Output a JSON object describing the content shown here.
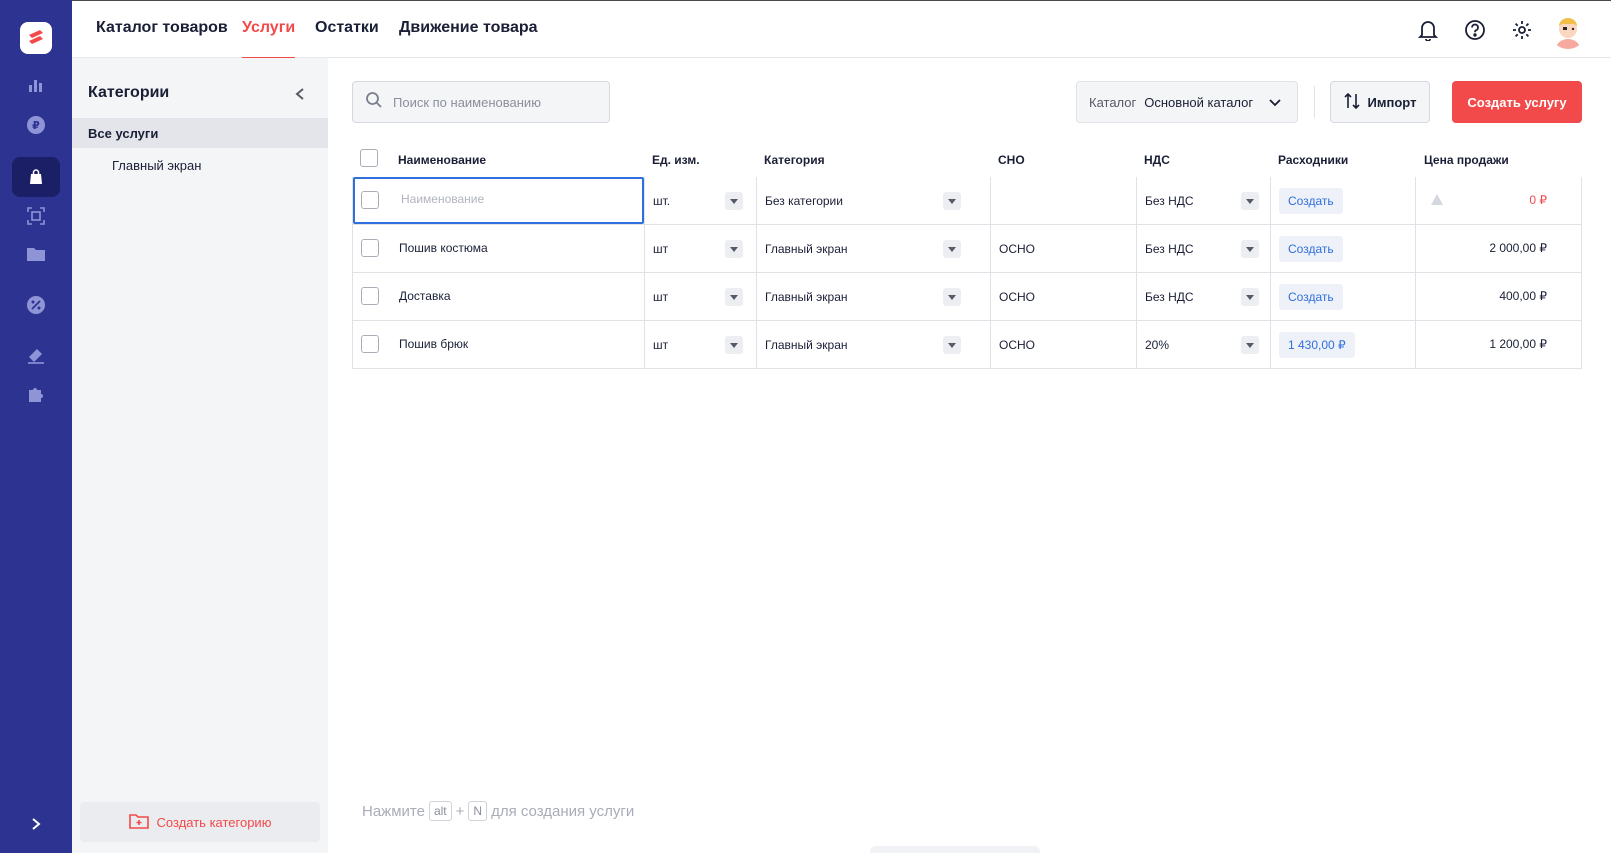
{
  "nav": {
    "tabs": [
      {
        "label": "Каталог товаров"
      },
      {
        "label": "Услуги"
      },
      {
        "label": "Остатки"
      },
      {
        "label": "Движение товара"
      }
    ]
  },
  "categories": {
    "title": "Категории",
    "items": [
      {
        "label": "Все услуги"
      },
      {
        "label": "Главный экран"
      }
    ],
    "create_label": "Создать категорию"
  },
  "toolbar": {
    "search_placeholder": "Поиск по наименованию",
    "catalog_label": "Каталог",
    "catalog_value": "Основной каталог",
    "import_label": "Импорт",
    "create_label": "Создать услугу"
  },
  "table": {
    "headers": {
      "name": "Наименование",
      "unit": "Ед. изм.",
      "category": "Категория",
      "sno": "СНО",
      "vat": "НДС",
      "supplies": "Расходники",
      "price": "Цена продажи"
    },
    "new_row": {
      "name_placeholder": "Наименование",
      "unit": "шт.",
      "category": "Без категории",
      "sno": "",
      "vat": "Без НДС",
      "supplies": "Создать",
      "price": "0 ₽"
    },
    "rows": [
      {
        "name": "Пошив костюма",
        "unit": "шт",
        "category": "Главный экран",
        "sno": "ОСНО",
        "vat": "Без НДС",
        "supplies": "Создать",
        "price": "2 000,00 ₽"
      },
      {
        "name": "Доставка",
        "unit": "шт",
        "category": "Главный экран",
        "sno": "ОСНО",
        "vat": "Без НДС",
        "supplies": "Создать",
        "price": "400,00 ₽"
      },
      {
        "name": "Пошив брюк",
        "unit": "шт",
        "category": "Главный экран",
        "sno": "ОСНО",
        "vat": "20%",
        "supplies": "1 430,00 ₽",
        "price": "1 200,00 ₽"
      }
    ]
  },
  "hint": {
    "prefix": "Нажмите",
    "key1": "alt",
    "plus": "+",
    "key2": "N",
    "suffix": "для создания услуги"
  },
  "colors": {
    "rail": "#2d3391",
    "accent": "#f24a4a",
    "link": "#2f6fde"
  }
}
